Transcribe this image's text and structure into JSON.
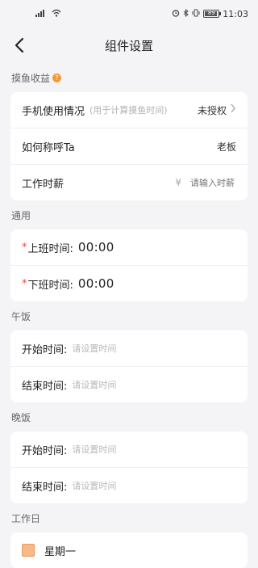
{
  "status_bar": {
    "time": "11:03",
    "battery_level": "89",
    "battery_fraction": 0.89,
    "left_icons": [
      "signal-icon",
      "wifi-icon"
    ],
    "right_icons": [
      "alarm-icon",
      "bluetooth-icon",
      "vibrate-icon",
      "battery-icon"
    ]
  },
  "navbar": {
    "title": "组件设置",
    "back_icon": "chevron-left-icon"
  },
  "section_moyu": {
    "label": "摸鱼收益",
    "help_glyph": "?",
    "rows": {
      "phone_usage": {
        "label": "手机使用情况",
        "hint": "(用于计算摸鱼时间)",
        "value": "未授权",
        "chevron": "›"
      },
      "nickname": {
        "label": "如何称呼Ta",
        "value": "老板"
      },
      "salary": {
        "label": "工作时薪",
        "currency": "¥",
        "placeholder": "请输入时薪"
      }
    }
  },
  "section_common": {
    "label": "通用",
    "rows": {
      "start_work": {
        "required": "*",
        "label": "上班时间:",
        "value": "00:00"
      },
      "end_work": {
        "required": "*",
        "label": "下班时间:",
        "value": "00:00"
      }
    }
  },
  "section_lunch": {
    "label": "午饭",
    "rows": {
      "start": {
        "label": "开始时间:",
        "placeholder": "请设置时间"
      },
      "end": {
        "label": "结束时间:",
        "placeholder": "请设置时间"
      }
    }
  },
  "section_dinner": {
    "label": "晚饭",
    "rows": {
      "start": {
        "label": "开始时间:",
        "placeholder": "请设置时间"
      },
      "end": {
        "label": "结束时间:",
        "placeholder": "请设置时间"
      }
    }
  },
  "section_workdays": {
    "label": "工作日",
    "days": [
      {
        "label": "星期一",
        "checked": true
      }
    ]
  },
  "colors": {
    "accent": "#f39a3a",
    "required": "#e24a3a",
    "checkbox_fill": "#f5b98a"
  }
}
